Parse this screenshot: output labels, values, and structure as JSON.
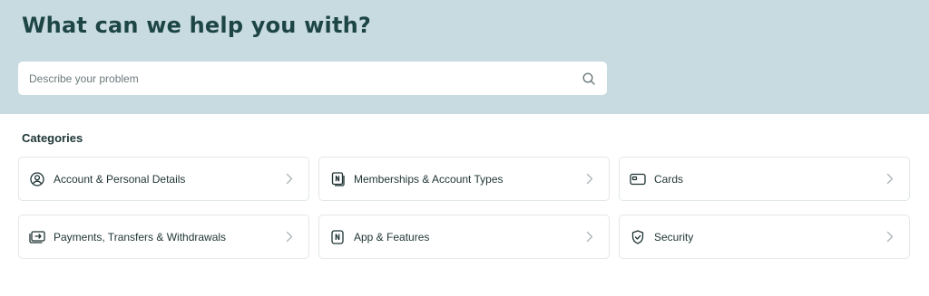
{
  "hero": {
    "title": "What can we help you with?"
  },
  "search": {
    "placeholder": "Describe your problem",
    "value": ""
  },
  "categories": {
    "heading": "Categories",
    "items": [
      {
        "label": "Account & Personal Details",
        "icon": "user-circle-icon"
      },
      {
        "label": "Memberships & Account Types",
        "icon": "membership-card-icon"
      },
      {
        "label": "Cards",
        "icon": "card-icon"
      },
      {
        "label": "Payments, Transfers & Withdrawals",
        "icon": "transfer-icon"
      },
      {
        "label": "App & Features",
        "icon": "phone-app-icon"
      },
      {
        "label": "Security",
        "icon": "shield-icon"
      }
    ]
  },
  "colors": {
    "hero_bg": "#c8dbe0",
    "title": "#1d4546",
    "card_border": "#e2e7e8",
    "chevron": "#aab5b7"
  }
}
